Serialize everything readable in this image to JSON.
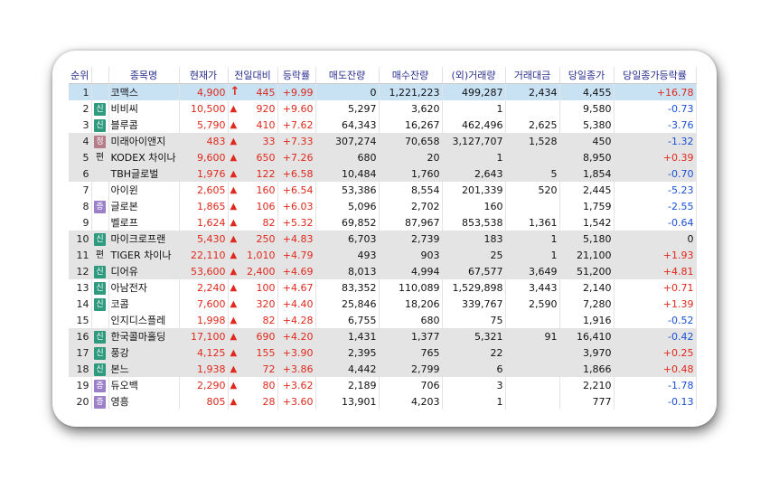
{
  "columns": [
    "순위",
    "종목명",
    "현재가",
    "전일대비",
    "등락률",
    "매도잔량",
    "매수잔량",
    "(외)거래량",
    "거래대금",
    "당일종가",
    "당일종가등락률"
  ],
  "colors": {
    "up": "#e0281c",
    "down": "#1a4fd6",
    "header_text": "#2a2f8f",
    "selected_row": "#c8e1f3",
    "alt_row": "#e4e4e4"
  },
  "badge_labels": {
    "sin": "신",
    "jeong": "정",
    "jeung": "증",
    "pyeon": "편"
  },
  "rows": [
    {
      "rank": "1",
      "badge": "",
      "name": "코맥스",
      "price": "4,900",
      "arrow": "up-arrow-bold",
      "change": "445",
      "rate": "+9.99",
      "ask": "0",
      "bid": "1,221,223",
      "volume": "499,287",
      "amount": "2,434",
      "close": "4,455",
      "close_rate": "+16.78",
      "close_dir": "up"
    },
    {
      "rank": "2",
      "badge": "sin",
      "name": "비비씨",
      "price": "10,500",
      "arrow": "up-triangle",
      "change": "920",
      "rate": "+9.60",
      "ask": "5,297",
      "bid": "3,620",
      "volume": "1",
      "amount": "",
      "close": "9,580",
      "close_rate": "-0.73",
      "close_dir": "down"
    },
    {
      "rank": "3",
      "badge": "sin",
      "name": "블루콤",
      "price": "5,790",
      "arrow": "up-triangle",
      "change": "410",
      "rate": "+7.62",
      "ask": "64,343",
      "bid": "16,267",
      "volume": "462,496",
      "amount": "2,625",
      "close": "5,380",
      "close_rate": "-3.76",
      "close_dir": "down"
    },
    {
      "rank": "4",
      "badge": "jeong",
      "name": "미래아이앤지",
      "price": "483",
      "arrow": "up-triangle",
      "change": "33",
      "rate": "+7.33",
      "ask": "307,274",
      "bid": "70,658",
      "volume": "3,127,707",
      "amount": "1,528",
      "close": "450",
      "close_rate": "-1.32",
      "close_dir": "down"
    },
    {
      "rank": "5",
      "badge": "pyeon",
      "name": "KODEX 차이나",
      "price": "9,600",
      "arrow": "up-triangle",
      "change": "650",
      "rate": "+7.26",
      "ask": "680",
      "bid": "20",
      "volume": "1",
      "amount": "",
      "close": "8,950",
      "close_rate": "+0.39",
      "close_dir": "up"
    },
    {
      "rank": "6",
      "badge": "",
      "name": "TBH글로벌",
      "price": "1,976",
      "arrow": "up-triangle",
      "change": "122",
      "rate": "+6.58",
      "ask": "10,484",
      "bid": "1,760",
      "volume": "2,643",
      "amount": "5",
      "close": "1,854",
      "close_rate": "-0.70",
      "close_dir": "down"
    },
    {
      "rank": "7",
      "badge": "",
      "name": "아이윈",
      "price": "2,605",
      "arrow": "up-triangle",
      "change": "160",
      "rate": "+6.54",
      "ask": "53,386",
      "bid": "8,554",
      "volume": "201,339",
      "amount": "520",
      "close": "2,445",
      "close_rate": "-5.23",
      "close_dir": "down"
    },
    {
      "rank": "8",
      "badge": "jeung",
      "name": "글로본",
      "price": "1,865",
      "arrow": "up-triangle",
      "change": "106",
      "rate": "+6.03",
      "ask": "5,096",
      "bid": "2,702",
      "volume": "160",
      "amount": "",
      "close": "1,759",
      "close_rate": "-2.55",
      "close_dir": "down"
    },
    {
      "rank": "9",
      "badge": "",
      "name": "벨로프",
      "price": "1,624",
      "arrow": "up-triangle",
      "change": "82",
      "rate": "+5.32",
      "ask": "69,852",
      "bid": "87,967",
      "volume": "853,538",
      "amount": "1,361",
      "close": "1,542",
      "close_rate": "-0.64",
      "close_dir": "down"
    },
    {
      "rank": "10",
      "badge": "sin",
      "name": "마이크로프랜",
      "price": "5,430",
      "arrow": "up-triangle",
      "change": "250",
      "rate": "+4.83",
      "ask": "6,703",
      "bid": "2,739",
      "volume": "183",
      "amount": "1",
      "close": "5,180",
      "close_rate": "0",
      "close_dir": "zero"
    },
    {
      "rank": "11",
      "badge": "pyeon",
      "name": "TIGER 차이나",
      "price": "22,110",
      "arrow": "up-triangle",
      "change": "1,010",
      "rate": "+4.79",
      "ask": "493",
      "bid": "903",
      "volume": "25",
      "amount": "1",
      "close": "21,100",
      "close_rate": "+1.93",
      "close_dir": "up"
    },
    {
      "rank": "12",
      "badge": "sin",
      "name": "디어유",
      "price": "53,600",
      "arrow": "up-triangle",
      "change": "2,400",
      "rate": "+4.69",
      "ask": "8,013",
      "bid": "4,994",
      "volume": "67,577",
      "amount": "3,649",
      "close": "51,200",
      "close_rate": "+4.81",
      "close_dir": "up"
    },
    {
      "rank": "13",
      "badge": "sin",
      "name": "아남전자",
      "price": "2,240",
      "arrow": "up-triangle",
      "change": "100",
      "rate": "+4.67",
      "ask": "83,352",
      "bid": "110,089",
      "volume": "1,529,898",
      "amount": "3,443",
      "close": "2,140",
      "close_rate": "+0.71",
      "close_dir": "up"
    },
    {
      "rank": "14",
      "badge": "sin",
      "name": "코콤",
      "price": "7,600",
      "arrow": "up-triangle",
      "change": "320",
      "rate": "+4.40",
      "ask": "25,846",
      "bid": "18,206",
      "volume": "339,767",
      "amount": "2,590",
      "close": "7,280",
      "close_rate": "+1.39",
      "close_dir": "up"
    },
    {
      "rank": "15",
      "badge": "",
      "name": "인지디스플레",
      "price": "1,998",
      "arrow": "up-triangle",
      "change": "82",
      "rate": "+4.28",
      "ask": "6,755",
      "bid": "680",
      "volume": "75",
      "amount": "",
      "close": "1,916",
      "close_rate": "-0.52",
      "close_dir": "down"
    },
    {
      "rank": "16",
      "badge": "sin",
      "name": "한국콜마홀딩",
      "price": "17,100",
      "arrow": "up-triangle",
      "change": "690",
      "rate": "+4.20",
      "ask": "1,431",
      "bid": "1,377",
      "volume": "5,321",
      "amount": "91",
      "close": "16,410",
      "close_rate": "-0.42",
      "close_dir": "down"
    },
    {
      "rank": "17",
      "badge": "sin",
      "name": "풍강",
      "price": "4,125",
      "arrow": "up-triangle",
      "change": "155",
      "rate": "+3.90",
      "ask": "2,395",
      "bid": "765",
      "volume": "22",
      "amount": "",
      "close": "3,970",
      "close_rate": "+0.25",
      "close_dir": "up"
    },
    {
      "rank": "18",
      "badge": "sin",
      "name": "본느",
      "price": "1,938",
      "arrow": "up-triangle",
      "change": "72",
      "rate": "+3.86",
      "ask": "4,442",
      "bid": "2,799",
      "volume": "6",
      "amount": "",
      "close": "1,866",
      "close_rate": "+0.48",
      "close_dir": "up"
    },
    {
      "rank": "19",
      "badge": "jeung",
      "name": "듀오백",
      "price": "2,290",
      "arrow": "up-triangle",
      "change": "80",
      "rate": "+3.62",
      "ask": "2,189",
      "bid": "706",
      "volume": "3",
      "amount": "",
      "close": "2,210",
      "close_rate": "-1.78",
      "close_dir": "down"
    },
    {
      "rank": "20",
      "badge": "jeung",
      "name": "영흥",
      "price": "805",
      "arrow": "up-triangle",
      "change": "28",
      "rate": "+3.60",
      "ask": "13,901",
      "bid": "4,203",
      "volume": "1",
      "amount": "",
      "close": "777",
      "close_rate": "-0.13",
      "close_dir": "down"
    }
  ]
}
